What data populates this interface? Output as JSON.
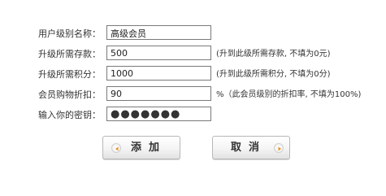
{
  "form": {
    "fields": [
      {
        "label": "用户级别名称：",
        "value": "高级会员",
        "hint": ""
      },
      {
        "label": "升级所需存款：",
        "value": "500",
        "hint": "(升到此级所需存款, 不填为0元)"
      },
      {
        "label": "升级所需积分：",
        "value": "1000",
        "hint": "(升到此级所需积分, 不填为0分)"
      },
      {
        "label": "会员购物折扣：",
        "value": "90",
        "hint": "%（此会员级别的折扣率, 不填为100%)"
      },
      {
        "label": "输入你的密钥：",
        "value": "●●●●●●●",
        "hint": ""
      }
    ]
  },
  "buttons": {
    "add_label": "添加",
    "cancel_label": "取消"
  },
  "icons": {
    "add": "arrow-left-icon",
    "cancel": "arrow-right-icon"
  },
  "colors": {
    "arrow": "#e8951f",
    "border": "#7a7a7a"
  }
}
